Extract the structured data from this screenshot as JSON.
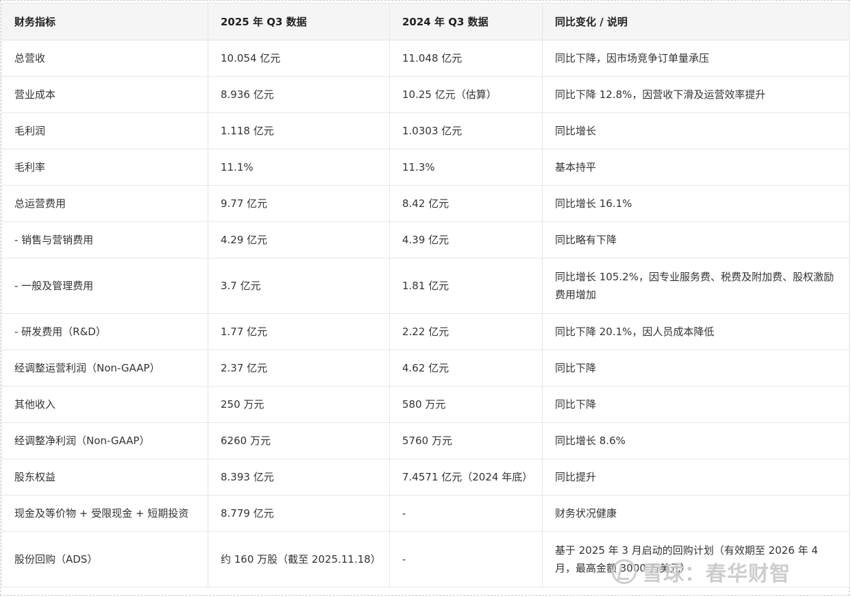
{
  "table": {
    "headers": [
      "财务指标",
      "2025 年 Q3 数据",
      "2024 年 Q3 数据",
      "同比变化 / 说明"
    ],
    "rows": [
      [
        "总营收",
        "10.054 亿元",
        "11.048 亿元",
        "同比下降，因市场竞争订单量承压"
      ],
      [
        "营业成本",
        "8.936 亿元",
        "10.25 亿元（估算）",
        "同比下降 12.8%，因营收下滑及运营效率提升"
      ],
      [
        "毛利润",
        "1.118 亿元",
        "1.0303 亿元",
        "同比增长"
      ],
      [
        "毛利率",
        "11.1%",
        "11.3%",
        "基本持平"
      ],
      [
        "总运营费用",
        "9.77 亿元",
        "8.42 亿元",
        "同比增长 16.1%"
      ],
      [
        "- 销售与营销费用",
        "4.29 亿元",
        "4.39 亿元",
        "同比略有下降"
      ],
      [
        "- 一般及管理费用",
        "3.7 亿元",
        "1.81 亿元",
        "同比增长 105.2%，因专业服务费、税费及附加费、股权激励费用增加"
      ],
      [
        "- 研发费用（R&D）",
        "1.77 亿元",
        "2.22 亿元",
        "同比下降 20.1%，因人员成本降低"
      ],
      [
        "经调整运营利润（Non-GAAP）",
        "2.37 亿元",
        "4.62 亿元",
        "同比下降"
      ],
      [
        "其他收入",
        "250 万元",
        "580 万元",
        "同比下降"
      ],
      [
        "经调整净利润（Non-GAAP）",
        "6260 万元",
        "5760 万元",
        "同比增长 8.6%"
      ],
      [
        "股东权益",
        "8.393 亿元",
        "7.4571 亿元（2024 年底）",
        "同比提升"
      ],
      [
        "现金及等价物 + 受限现金 + 短期投资",
        "8.779 亿元",
        "-",
        "财务状况健康"
      ],
      [
        "股份回购（ADS）",
        "约 160 万股（截至 2025.11.18）",
        "-",
        "基于 2025 年 3 月启动的回购计划（有效期至 2026 年 4 月，最高金额 3000 万美元）"
      ]
    ]
  },
  "watermark": {
    "text": "雪球：春华财智",
    "icon": "snowball-logo-icon"
  }
}
